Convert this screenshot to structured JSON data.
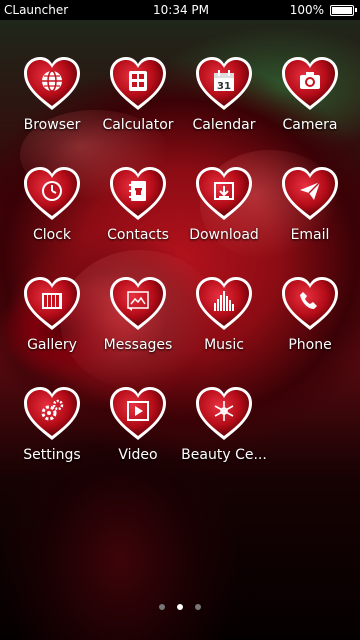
{
  "status": {
    "left": "CLauncher",
    "time": "10:34 PM",
    "battery_pct": "100%",
    "battery_fill": 1.0
  },
  "apps": [
    {
      "label": "Browser",
      "icon": "globe-icon"
    },
    {
      "label": "Calculator",
      "icon": "calculator-icon"
    },
    {
      "label": "Calendar",
      "icon": "calendar-icon",
      "day": "31"
    },
    {
      "label": "Camera",
      "icon": "camera-icon"
    },
    {
      "label": "Clock",
      "icon": "clock-icon"
    },
    {
      "label": "Contacts",
      "icon": "contacts-icon"
    },
    {
      "label": "Download",
      "icon": "download-icon"
    },
    {
      "label": "Email",
      "icon": "email-icon"
    },
    {
      "label": "Gallery",
      "icon": "gallery-icon"
    },
    {
      "label": "Messages",
      "icon": "messages-icon"
    },
    {
      "label": "Music",
      "icon": "music-icon"
    },
    {
      "label": "Phone",
      "icon": "phone-icon"
    },
    {
      "label": "Settings",
      "icon": "settings-icon"
    },
    {
      "label": "Video",
      "icon": "video-icon"
    },
    {
      "label": "Beauty Ce...",
      "icon": "snowflake-icon"
    }
  ],
  "pager": {
    "count": 3,
    "active": 2
  },
  "colors": {
    "heart": "#c4121e",
    "heart_edge": "#ffffff",
    "statusbar": "#000000"
  }
}
